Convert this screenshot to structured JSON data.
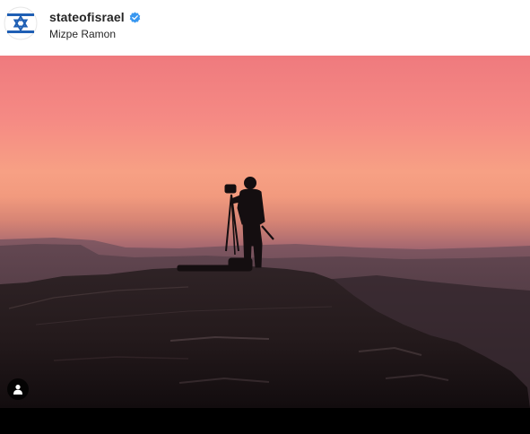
{
  "post": {
    "account_name": "stateofisrael",
    "location": "Mizpe Ramon",
    "verified": true
  },
  "icons": {
    "avatar": "star-of-david-icon",
    "verified": "verified-badge-icon",
    "tag": "person-tag-icon"
  },
  "colors": {
    "avatar_blue": "#1f5fb4",
    "verified_blue": "#3897f0",
    "sky_top": "#f0787a",
    "sky_horizon": "#f5a080"
  }
}
